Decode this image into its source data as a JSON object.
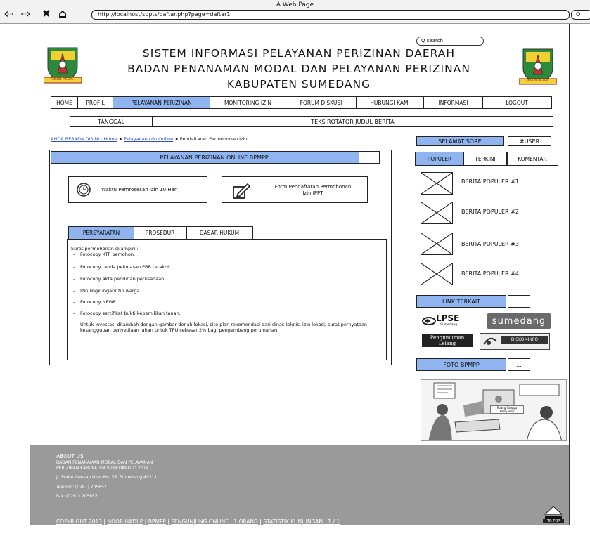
{
  "browser": {
    "window_title": "A Web Page",
    "url": "http://localhost/sppts/daftar.php?page=daftar1",
    "go_label": "Q",
    "back_glyph": "⇦",
    "forward_glyph": "⇨",
    "stop_glyph": "✖",
    "home_glyph": "⌂"
  },
  "header": {
    "search_placeholder": "Q search",
    "title_line1": "SISTEM INFORMASI PELAYANAN PERIZINAN DAERAH",
    "title_line2": "BADAN PENANAMAN MODAL DAN PELAYANAN PERIZINAN",
    "title_line3": "KABUPATEN SUMEDANG",
    "logo_ribbon": "INSUN MEDAL"
  },
  "nav": {
    "items": [
      "HOME",
      "PROFIL",
      "PELAYANAN PERIZINAN",
      "MONITORING IZIN",
      "FORUM DISKUSI",
      "HUBUNGI KAMI",
      "INFORMASI",
      "LOGOUT"
    ],
    "active_index": 2
  },
  "ticker": {
    "date": "TANGGAL",
    "text": "TEKS ROTATOR JUDUL BERITA"
  },
  "breadcrumb": {
    "prefix": "ANDA BERADA DISINI : Home",
    "sep": "➤",
    "link": "Pelayanan Izin Online",
    "current": "Pendaftaran Permohonan Izin"
  },
  "main": {
    "heading": "PELAYANAN PERIZINAN ONLINE BPMPP",
    "more_label": "...",
    "card_time": "Waktu Pemrosesan Izin 10 Hari",
    "card_form_line1": "Form Pendaftaran Permohonan",
    "card_form_line2": "Izin IPPT",
    "tabs": [
      "PERSYARATAN",
      "PROSEDUR",
      "DASAR HUKUM"
    ],
    "active_tab": 0,
    "intro": "Surat permohonan dilampiri :",
    "bullet": "-",
    "requirements": [
      "Fotocopy KTP pemohon.",
      "Fotocopy tanda pelunasan PBB terakhir.",
      "Fotocopy akta pendirian perusahaan.",
      "Izin lingkungan/izin warga.",
      "Fotocopy NPWP.",
      "Fotocopy sertifikat bukti kepemilikan tanah.",
      "Untuk investasi ditambah dengan gambar denah lokasi, site plan rekomendasi dari dinas teknis, izin lokasi, surat pernyataan kesanggupan penyediaan lahan untuk TPU sebesar 2% bagi pengembang perumahan."
    ]
  },
  "sidebar": {
    "greeting": "SELAMAT SORE",
    "user": "#USER",
    "tabs": [
      "POPULER",
      "TERKINI",
      "KOMENTAR"
    ],
    "active_tab": 0,
    "news": [
      "BERITA POPULER #1",
      "BERITA POPULER #2",
      "BERITA POPULER #3",
      "BERITA POPULER #4"
    ],
    "links_title": "LINK TERKAIT",
    "more_label": "...",
    "partner_lpse": "LPSE",
    "partner_lpse_sub": "Sumedang",
    "partner_sumedang": "sumedang",
    "partner_pengumuman": "Pengumuman Lelang",
    "partner_diskominfo": "DISKOMINFO",
    "photo_title": "FOTO BPMPP",
    "photo_sign": "Ruang Tunggu Pelayanan"
  },
  "footer": {
    "about_title": "ABOUT US",
    "org_line1": "BADAN PENANAMAN MODAL DAN PELAYANAN",
    "org_line2": "PERIZINAN KABUPATEN SUMEDANG © 2014",
    "address": "Jl. Prabu Geusan Ulun No. 36, Sumedang 45311",
    "phone": "Telepon: (0261) 205657",
    "fax": "Fax: (0261) 205657",
    "copyright": "COPYRIGHT 2013",
    "author": "NOOR HADI P",
    "org": "BPMPP",
    "online": "PENGUNJUNG ONLINE : 1 ORANG",
    "stats": "STATISTIK KUNJUNGAN : 1 / 1",
    "sep": "|",
    "to_top": "TO TOP"
  },
  "colors": {
    "accent": "#8fb4f0",
    "footer": "#9a9a9a",
    "link": "#2a4fd0"
  }
}
